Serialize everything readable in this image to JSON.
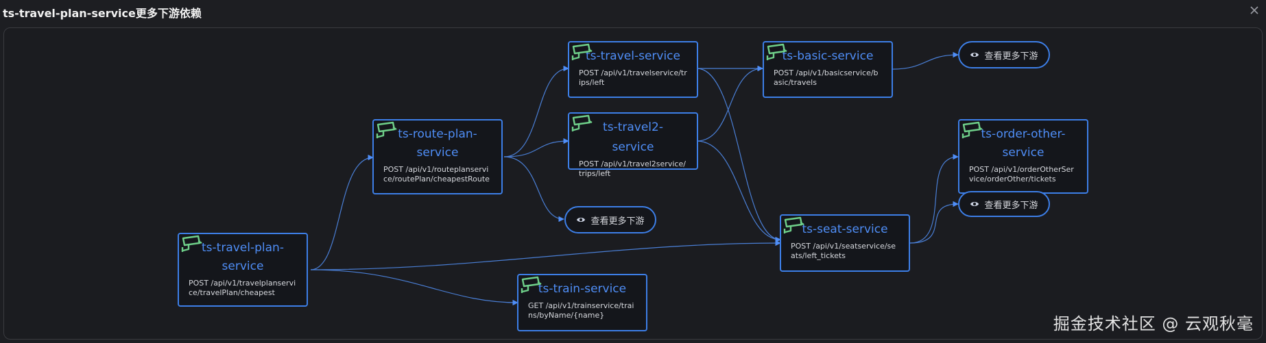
{
  "dialog": {
    "title": "ts-travel-plan-service更多下游依赖"
  },
  "nodes": {
    "travel_plan": {
      "title_line1": "ts-travel-plan-",
      "title_line2": "service",
      "endpoint": "POST /api/v1/travelplanservice/travelPlan/cheapest"
    },
    "route_plan": {
      "title_line1": "ts-route-plan-",
      "title_line2": "service",
      "endpoint": "POST /api/v1/routeplanservice/routePlan/cheapestRoute"
    },
    "travel": {
      "title_line1": "ts-travel-service",
      "endpoint": "POST /api/v1/travelservice/trips/left"
    },
    "travel2": {
      "title_line1": "ts-travel2-service",
      "endpoint": "POST /api/v1/travel2service/trips/left"
    },
    "basic": {
      "title_line1": "ts-basic-service",
      "endpoint": "POST /api/v1/basicservice/basic/travels"
    },
    "train": {
      "title_line1": "ts-train-service",
      "endpoint": "GET /api/v1/trainservice/trains/byName/{name}"
    },
    "seat": {
      "title_line1": "ts-seat-service",
      "endpoint": "POST /api/v1/seatservice/seats/left_tickets"
    },
    "order_other": {
      "title_line1": "ts-order-other-",
      "title_line2": "service",
      "endpoint": "POST /api/v1/orderOtherService/orderOther/tickets"
    }
  },
  "more_buttons": {
    "label": "查看更多下游"
  },
  "watermark": "掘金技术社区 @ 云观秋毫",
  "icons": {
    "node_icon": "camera-icon",
    "more_icon": "eye-icon",
    "close": "close-icon"
  },
  "colors": {
    "accent": "#3d7fe8",
    "node_icon": "#6fd08a",
    "background": "#1d1e22"
  }
}
